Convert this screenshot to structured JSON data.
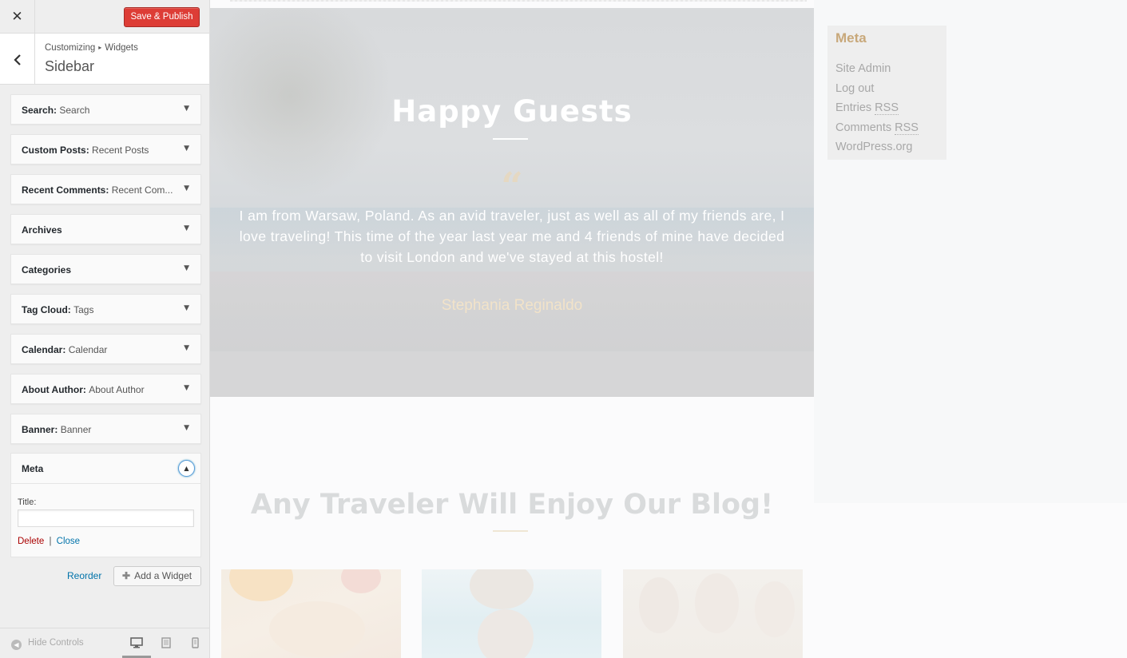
{
  "header": {
    "close_icon": "close-icon",
    "save_label": "Save & Publish",
    "save_color": "#dd3d36"
  },
  "section": {
    "breadcrumb_root": "Customizing",
    "breadcrumb_sep": "▸",
    "breadcrumb_child": "Widgets",
    "title": "Sidebar"
  },
  "widgets": [
    {
      "type": "Search",
      "instance": "Search"
    },
    {
      "type": "Custom Posts",
      "instance": "Recent Posts"
    },
    {
      "type": "Recent Comments",
      "instance": "Recent Com..."
    },
    {
      "type": "Archives",
      "instance": ""
    },
    {
      "type": "Categories",
      "instance": ""
    },
    {
      "type": "Tag Cloud",
      "instance": "Tags"
    },
    {
      "type": "Calendar",
      "instance": "Calendar"
    },
    {
      "type": "About Author",
      "instance": "About Author"
    },
    {
      "type": "Banner",
      "instance": "Banner"
    }
  ],
  "meta_widget": {
    "title": "Meta",
    "field_label": "Title:",
    "field_value": "",
    "delete_label": "Delete",
    "separator": "|",
    "close_label": "Close"
  },
  "actions": {
    "reorder_label": "Reorder",
    "add_widget_label": "Add a Widget"
  },
  "footer": {
    "hide_controls_label": "Hide Controls",
    "devices": [
      "desktop",
      "tablet",
      "mobile"
    ],
    "active_device": "desktop"
  },
  "preview": {
    "hero": {
      "title": "Happy Guests",
      "quote": "I am from Warsaw, Poland. As an avid traveler, just as well as all of my friends are, I love traveling! This time of the year last year me and 4 friends of mine have decided to visit London and we've stayed at this hostel!",
      "author": "Stephania Reginaldo"
    },
    "blog_title": "Any Traveler Will Enjoy Our Blog!",
    "sidebar_meta": {
      "heading": "Meta",
      "links": [
        {
          "text": "Site Admin",
          "abbr": ""
        },
        {
          "text": "Log out",
          "abbr": ""
        },
        {
          "text": "Entries ",
          "abbr": "RSS"
        },
        {
          "text": "Comments ",
          "abbr": "RSS"
        },
        {
          "text": "WordPress.org",
          "abbr": ""
        }
      ]
    }
  },
  "colors": {
    "accent_link": "#0073aa",
    "delete_link": "#aa0000",
    "meta_heading": "#c8a87a"
  }
}
